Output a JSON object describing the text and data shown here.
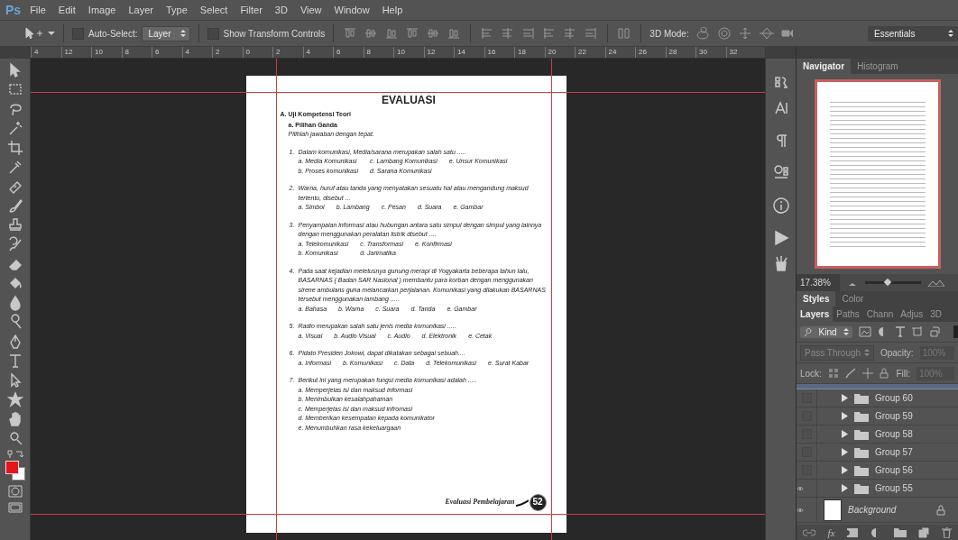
{
  "menu": {
    "logo": "Ps",
    "items": [
      "File",
      "Edit",
      "Image",
      "Layer",
      "Type",
      "Select",
      "Filter",
      "3D",
      "View",
      "Window",
      "Help"
    ]
  },
  "options_bar": {
    "auto_select": {
      "label": "Auto-Select:",
      "checked": false
    },
    "layer_select": "Layer",
    "show_transform": {
      "label": "Show Transform Controls",
      "checked": false
    },
    "mode_label": "3D Mode:",
    "workspace": "Essentials"
  },
  "ruler": {
    "labels": [
      "4",
      "12",
      "10",
      "8",
      "6",
      "4",
      "2",
      "0",
      "2",
      "4",
      "6",
      "8",
      "10",
      "12",
      "14",
      "16",
      "18",
      "20",
      "22",
      "24",
      "26",
      "28",
      "30",
      "32"
    ]
  },
  "document": {
    "title": "EVALUASI",
    "section": "A. Uji Kompetensi Teori",
    "subsection": "a. Pilihan Ganda",
    "instruction": "Pilihlah jawaban dengan tepat.",
    "questions": [
      {
        "number": "1.",
        "text": "Dalam komunikasi, Media/sarana merupakan salah satu .....",
        "options": [
          [
            "a. Media Komunikasi",
            "c. Lambang Komunikasi",
            "e. Unsur Komunikasi"
          ],
          [
            "b. Proses komunikasi",
            "d. Sarana Komunikasi"
          ]
        ]
      },
      {
        "number": "2.",
        "text": "Warna, huruf atau tanda yang menyatakan sesuatu hal atau mengandung maksud tertentu, disebut ...",
        "options": [
          [
            "a. Simbol",
            "b. Lambang",
            "c. Pesan",
            "d. Suara",
            "e. Gambar"
          ]
        ]
      },
      {
        "number": "3.",
        "text": "Penyampaian informasi atau hubungan antara satu simpul dengan simpul yang lainnya dengan menggunakan peralatan listrik disebut ....",
        "options": [
          [
            "a. Telekomunikasi",
            "c. Transformasi",
            "e. Konfirmasi"
          ],
          [
            "b. Komunikasi",
            "d. Jarimatika"
          ]
        ]
      },
      {
        "number": "4.",
        "text": "Pada saat kejadian meletusnya gunung merapi di Yogyakarta beberapa tahun lalu, BASARNAS ( Badan SAR Nasional ) membantu para korban dengan menggunakan sirene ambulans guna melancarkan perjalanan. Komunikasi  yang dilakukan BASARNAS tersebut menggunakan lambang .....",
        "options": [
          [
            "a. Bahasa",
            "b. Warna",
            "c. Suara",
            "d. Tanda",
            "e. Gambar"
          ]
        ]
      },
      {
        "number": "5.",
        "text": "Radio merupakan salah satu jenis media komunikasi .....",
        "options": [
          [
            "a. Visual",
            "b. Audio Visual",
            "c. Audio",
            "d. Elektronik",
            "e. Cetak"
          ]
        ]
      },
      {
        "number": "6.",
        "text": "Pidato Presiden Jokowi, dapat dikatakan sebagai sebuah....",
        "options": [
          [
            "a. Informasi",
            "b. Komunikasi",
            "c. Data",
            "d. Telekomunikasi",
            "e. Surat Kabar"
          ]
        ]
      },
      {
        "number": "7.",
        "text": "Berikut ini yang merupakan fungsi media komunikasi adalah .....",
        "options": [
          [
            "a. Memperjelas isi dan maksud informasi"
          ],
          [
            "b. Menimbulkan kesalahpahaman"
          ],
          [
            "c. Memperjelas isi dan maksud infromasi"
          ],
          [
            "d. Memberikan kesempatan kepada komunikator"
          ],
          [
            "e. Menumbuhkan rasa kekeluargaan"
          ]
        ]
      }
    ],
    "footer": "Evaluasi Pembelajaran",
    "page_number": "52"
  },
  "navigator": {
    "tabs": [
      {
        "label": "Navigator",
        "selected": true
      },
      {
        "label": "Histogram",
        "selected": false
      }
    ],
    "zoom": "17.38%",
    "level": 0.4
  },
  "styles_panel": {
    "tabs": [
      {
        "label": "Styles",
        "selected": true
      },
      {
        "label": "Color",
        "selected": false
      }
    ]
  },
  "layers_panel": {
    "tabs": [
      {
        "label": "Layers",
        "selected": true
      },
      {
        "label": "Paths",
        "selected": false
      },
      {
        "label": "Chann",
        "selected": false
      },
      {
        "label": "Adjus",
        "selected": false
      },
      {
        "label": "3D",
        "selected": false
      }
    ],
    "filter": "Kind",
    "blend_mode": "Pass Through",
    "opacity_label": "Opacity:",
    "opacity": "100%",
    "lock_label": "Lock:",
    "fill_label": "Fill:",
    "fill": "100%",
    "fields_disabled": true,
    "layers": [
      {
        "name": "Group 60",
        "kind": "group",
        "visible": false
      },
      {
        "name": "Group 59",
        "kind": "group",
        "visible": false
      },
      {
        "name": "Group 58",
        "kind": "group",
        "visible": false
      },
      {
        "name": "Group 57",
        "kind": "group",
        "visible": false
      },
      {
        "name": "Group 56",
        "kind": "group",
        "visible": false
      },
      {
        "name": "Group 55",
        "kind": "group",
        "visible": true
      },
      {
        "name": "Background",
        "kind": "background",
        "visible": true
      }
    ],
    "effects_label": "fx"
  }
}
